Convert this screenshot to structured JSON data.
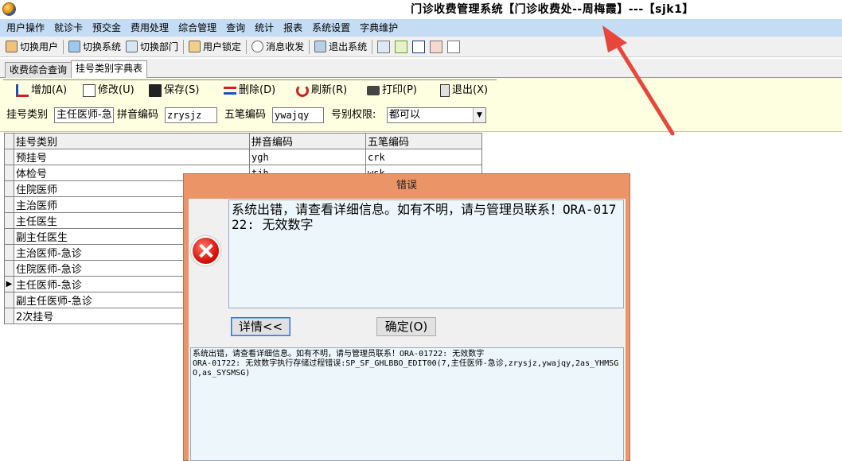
{
  "window": {
    "title": "门诊收费管理系统【门诊收费处--周梅霞】---【sjk1】"
  },
  "menu": [
    "用户操作",
    "就诊卡",
    "预交金",
    "费用处理",
    "综合管理",
    "查询",
    "统计",
    "报表",
    "系统设置",
    "字典维护"
  ],
  "toolbar": {
    "buttons": [
      "切换用户",
      "切换系统",
      "切换部门",
      "用户锁定",
      "消息收发",
      "退出系统"
    ]
  },
  "tabs": [
    "收费综合查询",
    "挂号类别字典表"
  ],
  "actions": {
    "add": "增加(A)",
    "edit": "修改(U)",
    "save": "保存(S)",
    "delete": "删除(D)",
    "refresh": "刷新(R)",
    "print": "打印(P)",
    "exit": "退出(X)"
  },
  "form": {
    "category_label": "挂号类别",
    "category_value": "主任医师-急",
    "pinyin_label": "拼音编码",
    "pinyin_value": "zrysjz",
    "wubi_label": "五笔编码",
    "wubi_value": "ywajqy",
    "permission_label": "号别权限:",
    "permission_value": "都可以"
  },
  "grid": {
    "columns": [
      "挂号类别",
      "拼音编码",
      "五笔编码"
    ],
    "rows": [
      [
        "预挂号",
        "ygh",
        "crk"
      ],
      [
        "体检号",
        "tjh",
        "wsk"
      ],
      [
        "住院医师",
        "",
        ""
      ],
      [
        "主治医师",
        "",
        ""
      ],
      [
        "主任医生",
        "",
        ""
      ],
      [
        "副主任医生",
        "",
        ""
      ],
      [
        "主治医师-急诊",
        "",
        ""
      ],
      [
        "住院医师-急诊",
        "",
        ""
      ],
      [
        "主任医师-急诊",
        "",
        ""
      ],
      [
        "副主任医师-急诊",
        "",
        ""
      ],
      [
        "2次挂号",
        "",
        ""
      ]
    ],
    "current_row": 8
  },
  "dialog": {
    "title": "错误",
    "message": "系统出错，请查看详细信息。如有不明，请与管理员联系！ORA-01722: 无效数字",
    "detail_button": "详情<<",
    "ok_button": "确定(O)",
    "detail_text": "系统出错，请查看详细信息。如有不明，请与管理员联系！ORA-01722: 无效数字\nORA-01722: 无效数字执行存储过程错误:SP_SF_GHLBBO_EDIT00(7,主任医师-急诊,zrysjz,ywajqy,2as_YHMSGO,as_SYSMSG)"
  },
  "colors": {
    "menubar": "#c4dcf4",
    "panel": "#fefee0",
    "dialog_frame": "#ea9468",
    "message_bg": "#edf7fb",
    "arrow": "#e8463a"
  }
}
